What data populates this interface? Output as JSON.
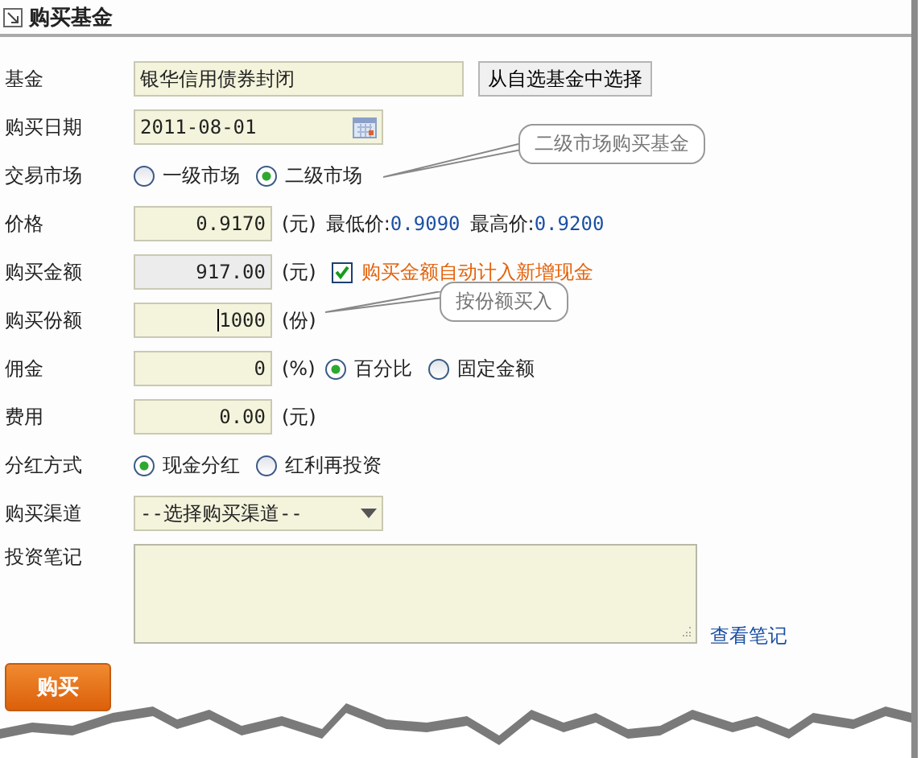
{
  "title": "购买基金",
  "fields": [
    {
      "kind": "text",
      "label": "基金",
      "value": "银华信用债券封闭",
      "button": "从自选基金中选择"
    },
    {
      "kind": "date",
      "label": "购买日期",
      "value": "2011-08-01"
    },
    {
      "kind": "radio",
      "label": "交易市场",
      "options": [
        {
          "label": "一级市场",
          "selected": false
        },
        {
          "label": "二级市场",
          "selected": true
        }
      ],
      "callout": "二级市场购买基金"
    },
    {
      "kind": "number",
      "label": "价格",
      "value": "0.9170",
      "unit": "(元)",
      "prices": [
        {
          "label": "最低价:",
          "value": "0.9090"
        },
        {
          "label": "最高价:",
          "value": "0.9200"
        }
      ]
    },
    {
      "kind": "number",
      "label": "购买金额",
      "value": "917.00",
      "disabled": true,
      "unit": "(元)",
      "checkbox": {
        "label": "购买金额自动计入新增现金",
        "checked": true
      }
    },
    {
      "kind": "number",
      "label": "购买份额",
      "value": "1000",
      "focused": true,
      "unit": "(份)",
      "callout": "按份额买入"
    },
    {
      "kind": "number",
      "label": "佣金",
      "value": "0",
      "unit": "(%)",
      "options": [
        {
          "label": "百分比",
          "selected": true
        },
        {
          "label": "固定金额",
          "selected": false
        }
      ]
    },
    {
      "kind": "number",
      "label": "费用",
      "value": "0.00",
      "unit": "(元)"
    },
    {
      "kind": "radio",
      "label": "分红方式",
      "options": [
        {
          "label": "现金分红",
          "selected": true
        },
        {
          "label": "红利再投资",
          "selected": false
        }
      ]
    },
    {
      "kind": "select",
      "label": "购买渠道",
      "value": "--选择购买渠道--"
    },
    {
      "kind": "textarea",
      "label": "投资笔记",
      "link": "查看笔记"
    }
  ],
  "submit": "购买"
}
